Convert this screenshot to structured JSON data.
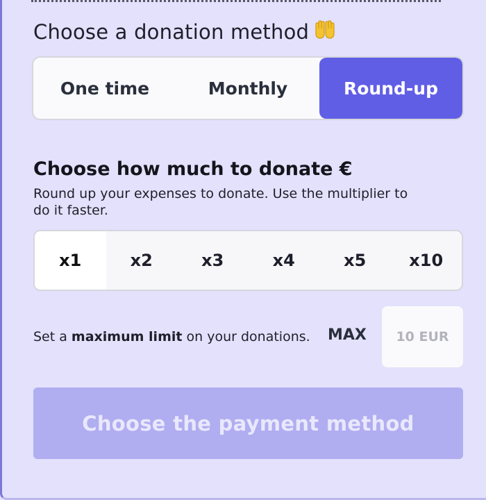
{
  "method_section": {
    "title": "Choose a donation method",
    "icon": "raised-hands-icon",
    "options": [
      "One time",
      "Monthly",
      "Round-up"
    ],
    "selected": "Round-up"
  },
  "amount_section": {
    "title": "Choose how much to donate €",
    "description": "Round up your expenses to donate. Use the multiplier to do it faster.",
    "multipliers": [
      "x1",
      "x2",
      "x3",
      "x4",
      "x5",
      "x10"
    ],
    "selected_multiplier": "x1"
  },
  "limit_section": {
    "text_before": "Set a ",
    "text_bold": "maximum limit",
    "text_after": " on your donations.",
    "max_label": "MAX",
    "input_placeholder": "10 EUR",
    "input_value": ""
  },
  "submit": {
    "label": "Choose the payment method"
  },
  "colors": {
    "accent": "#615ee6",
    "background": "#e3e1fb",
    "button_disabled": "#b0adf1"
  }
}
